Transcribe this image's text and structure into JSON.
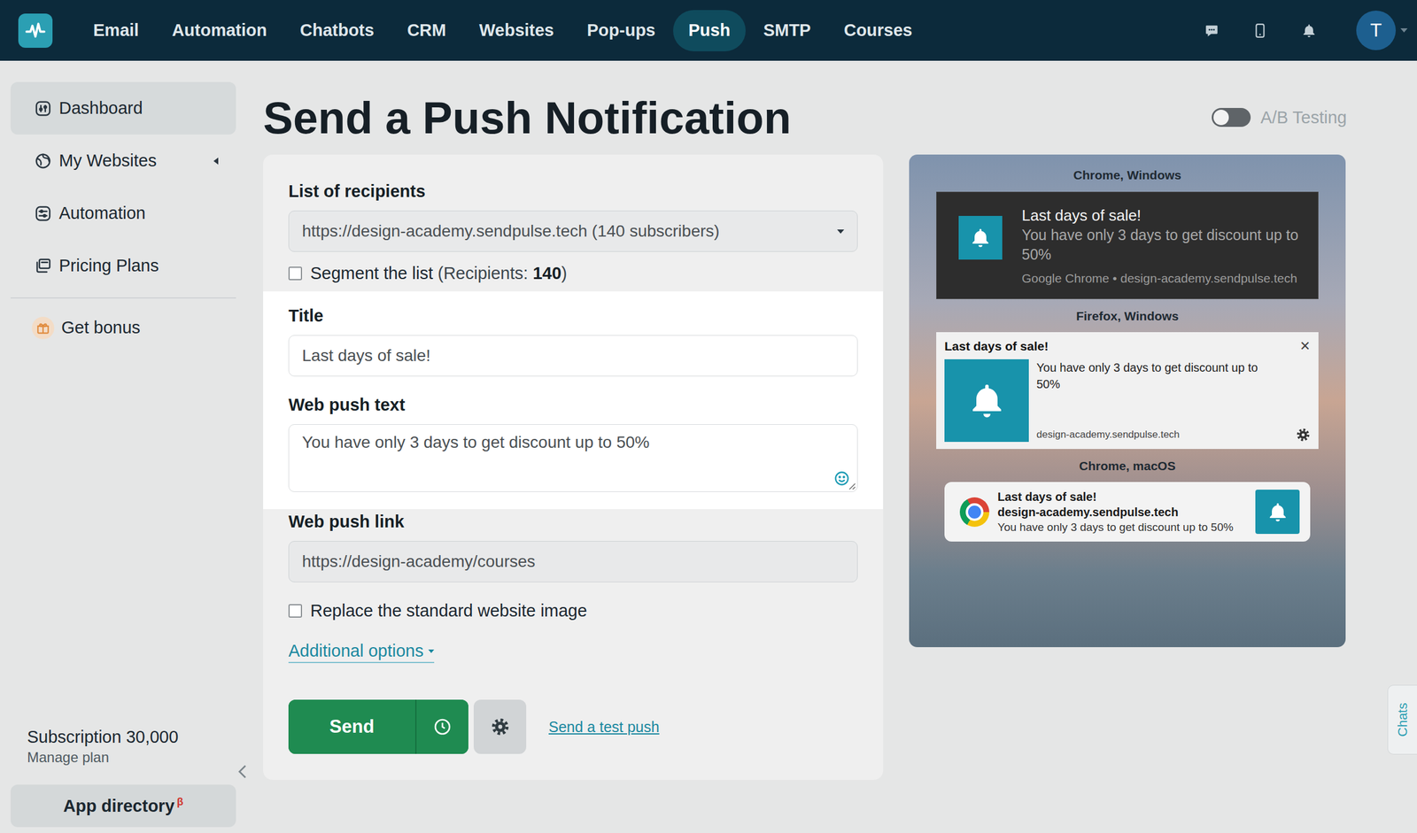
{
  "nav": {
    "items": [
      {
        "label": "Email",
        "selected": false
      },
      {
        "label": "Automation",
        "selected": false
      },
      {
        "label": "Chatbots",
        "selected": false
      },
      {
        "label": "CRM",
        "selected": false
      },
      {
        "label": "Websites",
        "selected": false
      },
      {
        "label": "Pop-ups",
        "selected": false
      },
      {
        "label": "Push",
        "selected": true
      },
      {
        "label": "SMTP",
        "selected": false
      },
      {
        "label": "Courses",
        "selected": false
      }
    ]
  },
  "user": {
    "initial": "T"
  },
  "sidebar": {
    "items": [
      {
        "label": "Dashboard",
        "selected": true,
        "expandable": false,
        "expanded": false
      },
      {
        "label": "My Websites",
        "selected": false,
        "expandable": true,
        "expanded": false
      },
      {
        "label": "Automation",
        "selected": false,
        "expandable": false,
        "expanded": false
      },
      {
        "label": "Pricing Plans",
        "selected": false,
        "expandable": false,
        "expanded": false
      }
    ],
    "bonus": {
      "label": "Get bonus"
    },
    "subscription": {
      "label": "Subscription 30,000",
      "link": "Manage plan"
    },
    "app_directory": {
      "label": "App directory",
      "badge": "β"
    }
  },
  "page": {
    "title": "Send a Push Notification"
  },
  "ab_testing": {
    "label": "A/B Testing",
    "on": false
  },
  "form": {
    "recipients": {
      "label": "List of recipients",
      "value": "https://design-academy.sendpulse.tech (140 subscribers)"
    },
    "segment": {
      "label": "Segment the list",
      "note_prefix": "(Recipients: ",
      "count": "140",
      "note_suffix": ")",
      "checked": false
    },
    "title": {
      "label": "Title",
      "value": "Last days of sale!"
    },
    "text": {
      "label": "Web push text",
      "value": "You have only 3 days to get discount up to 50%"
    },
    "link": {
      "label": "Web push link",
      "value": "https://design-academy/courses"
    },
    "replace_image": {
      "label": "Replace the standard website image",
      "checked": false
    },
    "additional": "Additional options",
    "send": "Send",
    "test": "Send a test push"
  },
  "preview": {
    "notifications": [
      {
        "kind": "chrome-windows",
        "platform": "Chrome, Windows",
        "title": "Last days of sale!",
        "text": "You have only 3 days to get discount up to 50%",
        "source": "Google Chrome • design-academy.sendpulse.tech"
      },
      {
        "kind": "firefox-windows",
        "platform": "Firefox, Windows",
        "title": "Last days of sale!",
        "text": "You have only 3 days to get discount up to 50%",
        "source": "design-academy.sendpulse.tech",
        "close": "✕"
      },
      {
        "kind": "chrome-macos",
        "platform": "Chrome, macOS",
        "title": "Last days of sale!",
        "text": "You have only 3 days to get discount up to 50%",
        "source": "design-academy.sendpulse.tech"
      }
    ]
  },
  "chats": "Chats"
}
